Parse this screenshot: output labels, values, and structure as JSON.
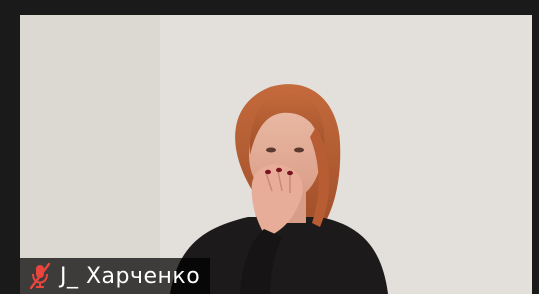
{
  "participant": {
    "name": "J_ Харченко",
    "microphone": "muted",
    "mic_icon": "microphone-muted-icon"
  },
  "colors": {
    "window_background": "#1a1a1a",
    "muted_icon": "#e8453c",
    "name_tag_background": "#000000"
  }
}
